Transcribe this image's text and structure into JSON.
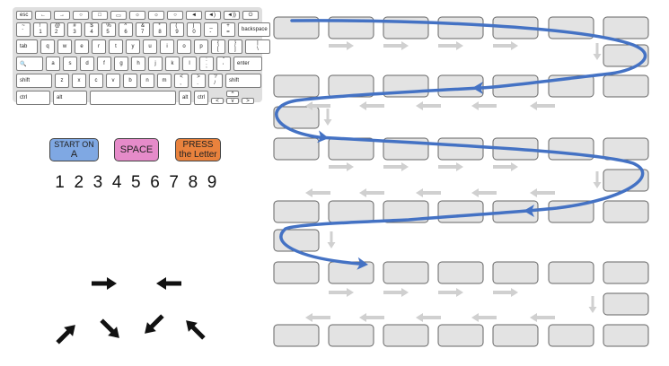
{
  "keyboard": {
    "rows": [
      {
        "type": "fn",
        "keys": [
          "esc",
          "←",
          "→",
          "○",
          "□",
          "▭",
          "☼",
          "☼",
          "○",
          "◄",
          "◄)",
          "◄))",
          "⏻"
        ]
      },
      {
        "type": "main",
        "keys": [
          "~\n`",
          "!\n1",
          "@\n2",
          "#\n3",
          "$\n4",
          "%\n5",
          "^\n6",
          "&\n7",
          "*\n8",
          "(\n9",
          ")\n0",
          "_\n-",
          "+\n=",
          "backspace"
        ]
      },
      {
        "type": "main",
        "keys": [
          "tab",
          "q",
          "w",
          "e",
          "r",
          "t",
          "y",
          "u",
          "i",
          "o",
          "p",
          "{\n[",
          "}\n]",
          "|\n\\"
        ]
      },
      {
        "type": "main",
        "keys": [
          "🔍",
          "a",
          "s",
          "d",
          "f",
          "g",
          "h",
          "j",
          "k",
          "l",
          ":\n;",
          "\"\n'",
          "enter"
        ]
      },
      {
        "type": "main",
        "keys": [
          "shift",
          "z",
          "x",
          "c",
          "v",
          "b",
          "n",
          "m",
          "<\n,",
          ">\n.",
          "?\n/",
          "shift"
        ]
      },
      {
        "type": "bottom",
        "keys": [
          "ctrl",
          "alt",
          "",
          "alt",
          "ctrl",
          "<",
          "^",
          "v",
          ">"
        ]
      }
    ]
  },
  "legend": {
    "start": {
      "label_top": "START ON",
      "label_bottom": "A",
      "color": "#7fa8e3"
    },
    "space": {
      "label": "SPACE",
      "color": "#e58bc9"
    },
    "press": {
      "label_top": "PRESS",
      "label_bottom": "the Letter",
      "color": "#e9823d"
    }
  },
  "numbers": [
    "1",
    "2",
    "3",
    "4",
    "5",
    "6",
    "7",
    "8",
    "9"
  ],
  "arrows": [
    {
      "name": "right-arrow-icon",
      "angle": 0
    },
    {
      "name": "left-arrow-icon",
      "angle": 180
    },
    {
      "name": "up-right-arrow-icon",
      "angle": -45
    },
    {
      "name": "down-right-arrow-icon",
      "angle": 45
    },
    {
      "name": "down-left-arrow-icon",
      "angle": 135
    },
    {
      "name": "up-left-arrow-icon",
      "angle": -135
    }
  ],
  "colors": {
    "path": "#4472c4",
    "cell": "#e3e3e3",
    "guide_arrow": "#d0d0d0"
  }
}
